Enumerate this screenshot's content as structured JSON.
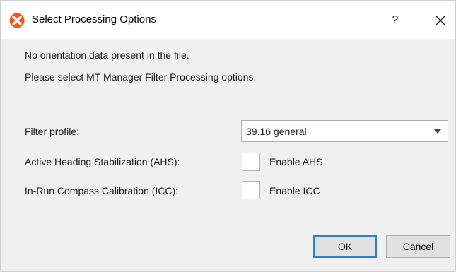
{
  "window": {
    "title": "Select Processing Options",
    "help_label": "?",
    "close_label": "✕"
  },
  "messages": {
    "line1": "No orientation data present in the file.",
    "line2": "Please select MT Manager Filter Processing options."
  },
  "form": {
    "filter_profile": {
      "label": "Filter profile:",
      "value": "39.16 general"
    },
    "ahs": {
      "label": "Active Heading Stabilization (AHS):",
      "checkbox_label": "Enable AHS",
      "checked": false
    },
    "icc": {
      "label": "In-Run Compass Calibration (ICC):",
      "checkbox_label": "Enable ICC",
      "checked": false
    }
  },
  "buttons": {
    "ok": "OK",
    "cancel": "Cancel"
  },
  "colors": {
    "icon_orange": "#f25c1a",
    "focus_blue": "#2f7fd7"
  },
  "icons": {
    "app": "xsens-x-icon",
    "dropdown": "chevron-down-icon",
    "close": "close-icon"
  }
}
